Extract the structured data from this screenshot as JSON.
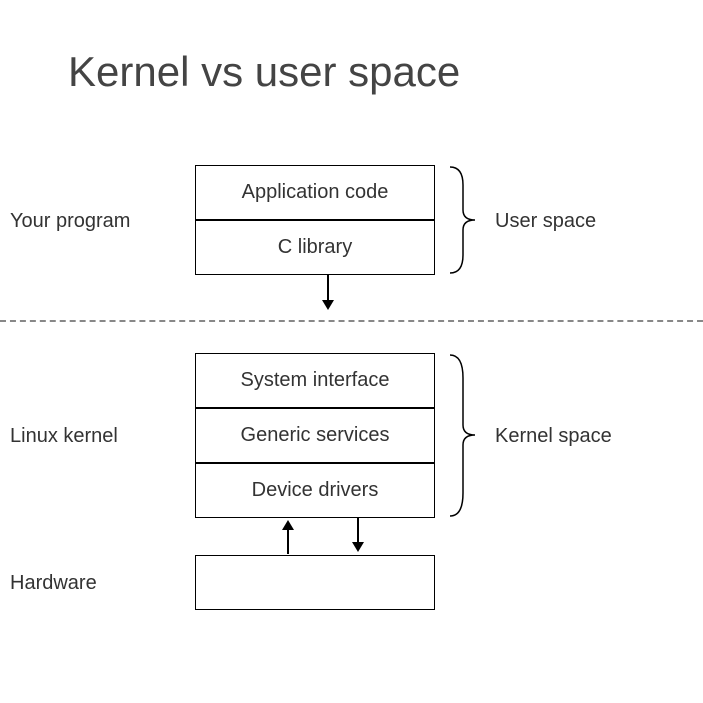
{
  "title": "Kernel vs user space",
  "boxes": {
    "app_code": "Application code",
    "c_library": "C library",
    "system_interface": "System interface",
    "generic_services": "Generic services",
    "device_drivers": "Device drivers",
    "hardware_box": ""
  },
  "labels": {
    "your_program": "Your program",
    "linux_kernel": "Linux kernel",
    "hardware": "Hardware",
    "user_space": "User space",
    "kernel_space": "Kernel space"
  }
}
